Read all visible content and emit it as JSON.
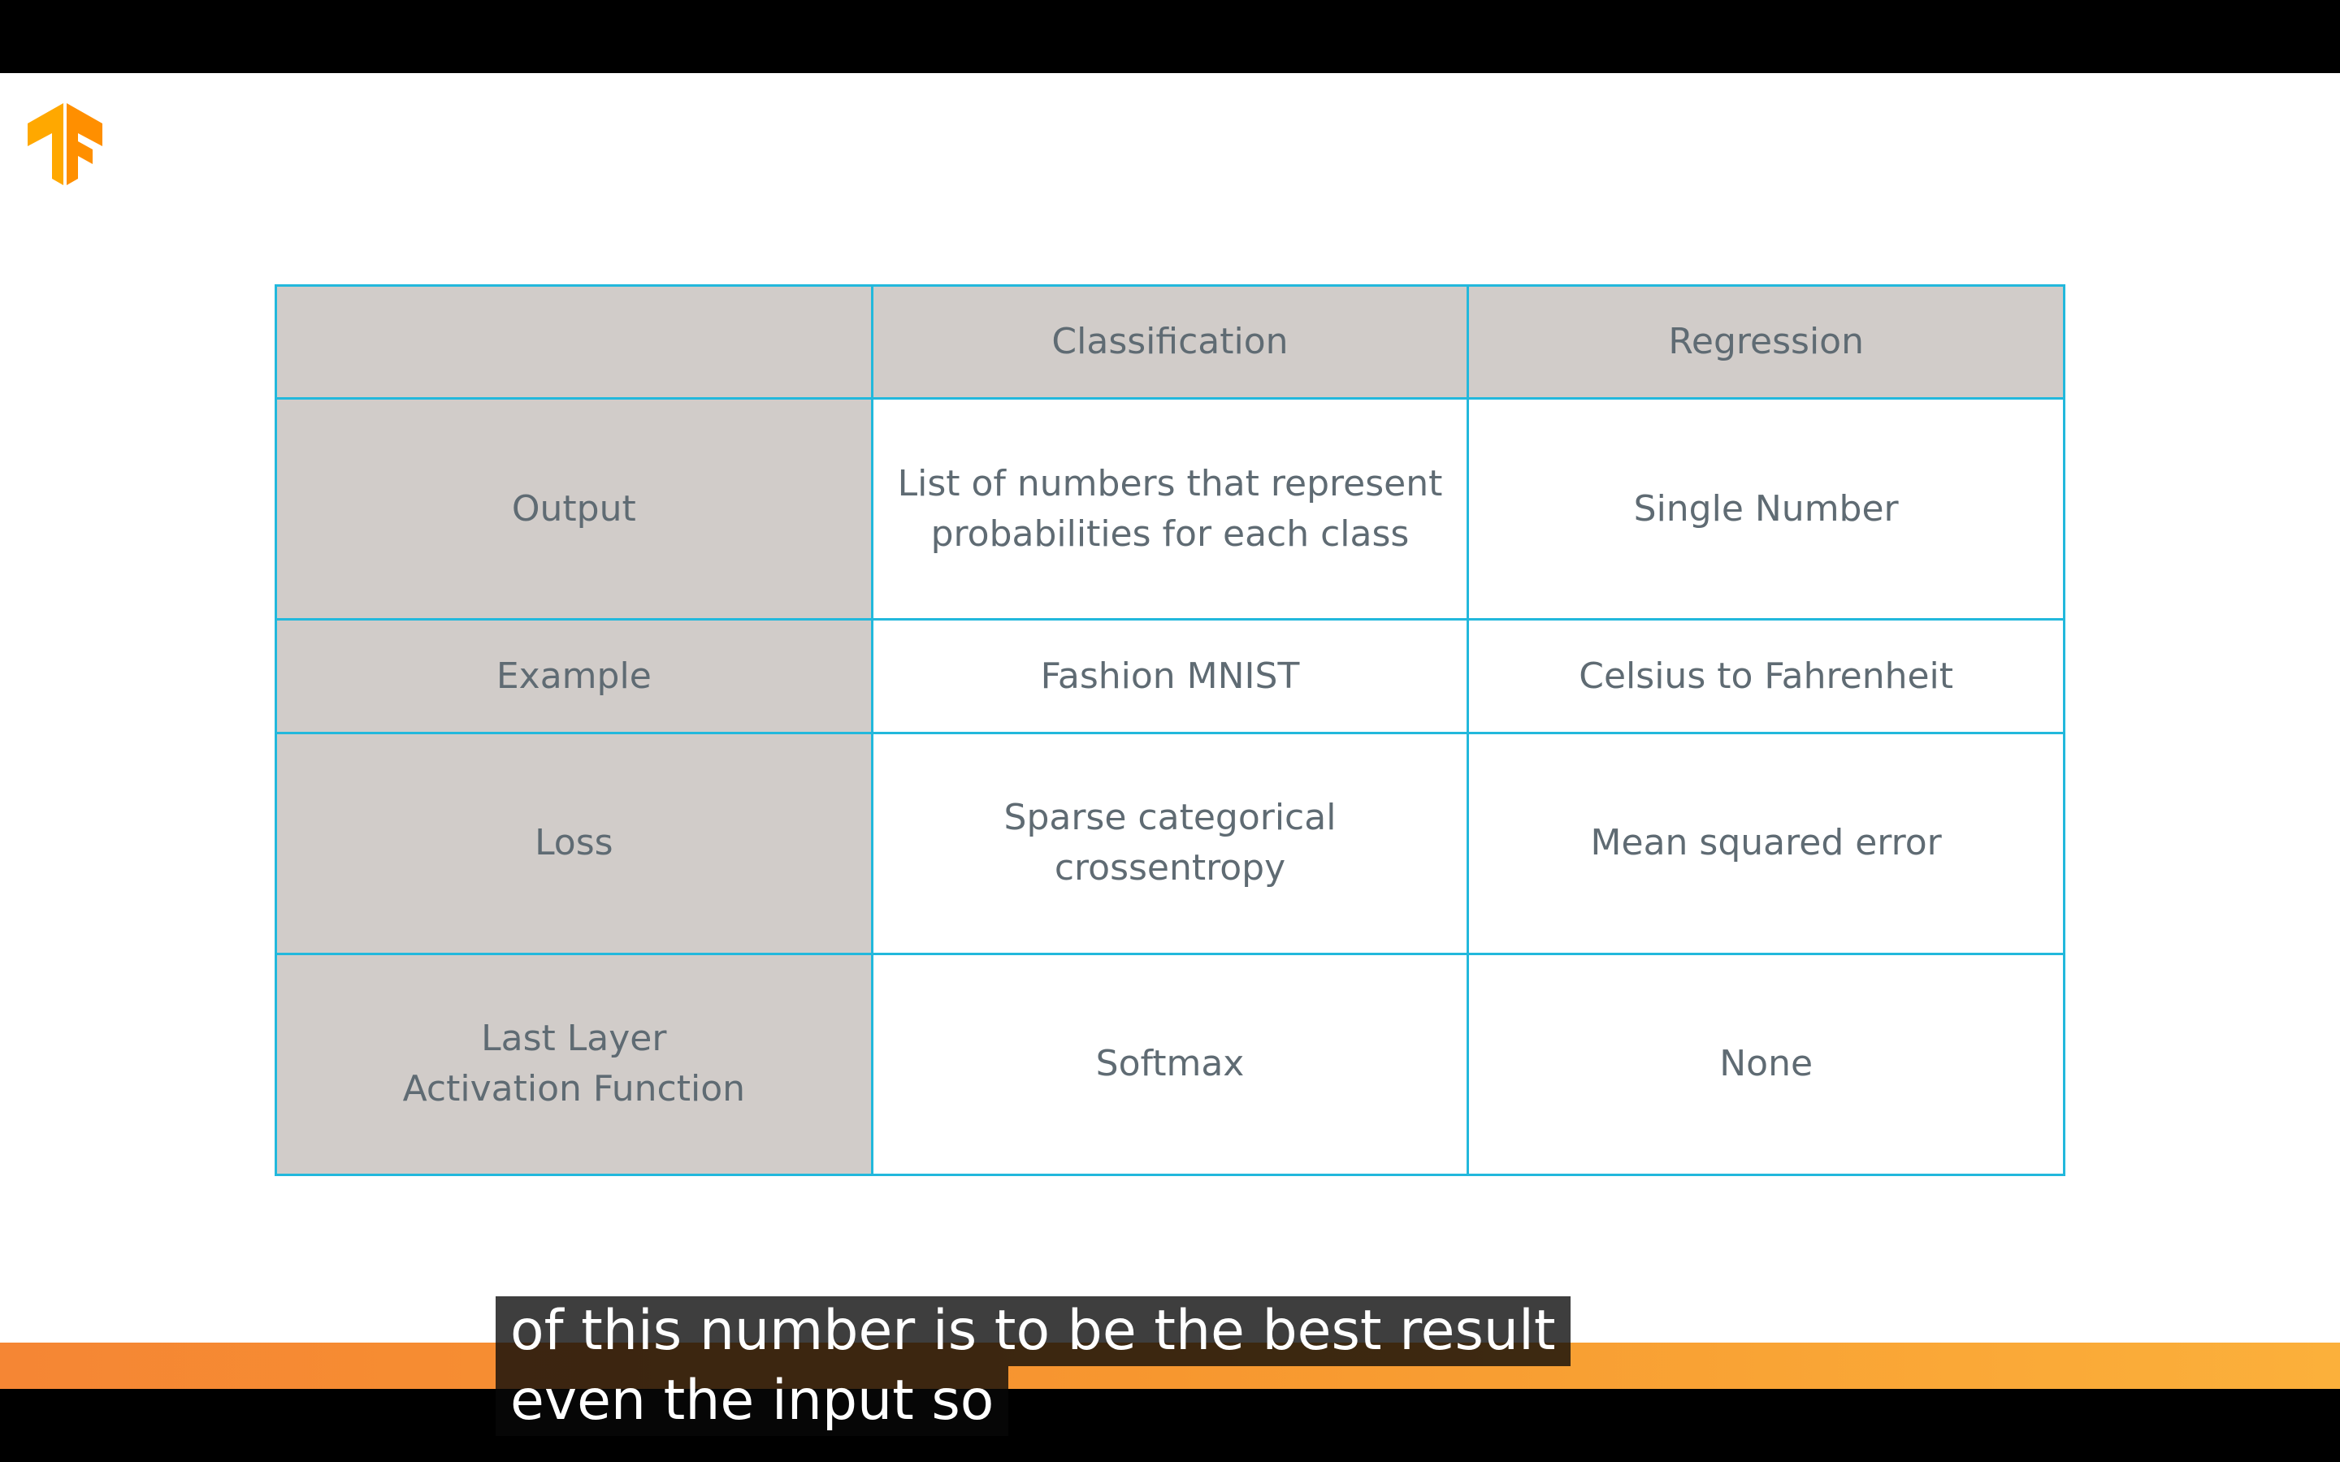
{
  "table": {
    "header": [
      "",
      "Classification",
      "Regression"
    ],
    "rows": [
      {
        "label": [
          "Output"
        ],
        "classification": [
          "List of numbers that represent",
          "probabilities for each class"
        ],
        "regression": [
          "Single Number"
        ]
      },
      {
        "label": [
          "Example"
        ],
        "classification": [
          "Fashion MNIST"
        ],
        "regression": [
          "Celsius to Fahrenheit"
        ]
      },
      {
        "label": [
          "Loss"
        ],
        "classification": [
          "Sparse categorical",
          "crossentropy"
        ],
        "regression": [
          "Mean squared error"
        ]
      },
      {
        "label": [
          "Last Layer",
          "Activation Function"
        ],
        "classification": [
          "Softmax"
        ],
        "regression": [
          "None"
        ]
      }
    ]
  },
  "captions": {
    "line1": "of this number is to be the best result",
    "line2": "even the input so"
  },
  "logo": {
    "icon": "tensorflow-logo-icon",
    "color_light": "#ffa800",
    "color_dark": "#ff6f00"
  },
  "colors": {
    "table_border": "#22b8dc",
    "header_fill": "#d1ccc9",
    "band_start": "#f58634",
    "band_end": "#fbb03b"
  }
}
